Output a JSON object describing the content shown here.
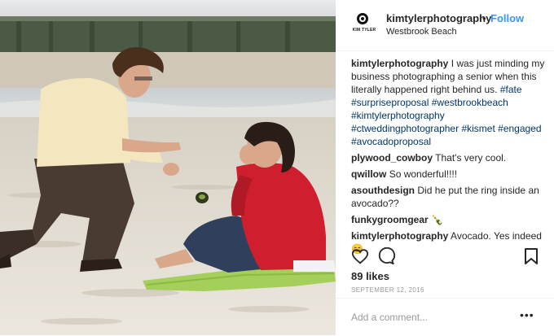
{
  "header": {
    "avatar_text": "KIM TYLER",
    "username": "kimtylerphotography",
    "separator": "•",
    "follow_label": "Follow",
    "location": "Westbrook Beach"
  },
  "caption": {
    "username": "kimtylerphotography",
    "text": "I was just minding my business photographing a senior when this literally happened right behind us.",
    "hashtags": [
      "#fate",
      "#surpriseproposal",
      "#westbrookbeach",
      "#kimtylerphotography",
      "#ctweddingphotographer",
      "#kismet",
      "#engaged",
      "#avocadoproposal"
    ]
  },
  "comments": [
    {
      "username": "plywood_cowboy",
      "text": "That's very cool."
    },
    {
      "username": "qwillow",
      "text": "So wonderful!!!!"
    },
    {
      "username": "asouthdesign",
      "text": "Did he put the ring inside an avocado??"
    },
    {
      "username": "funkygroomgear",
      "text": "🍾"
    },
    {
      "username": "kimtylerphotography",
      "text": "Avocado. Yes indeed 😊"
    }
  ],
  "actions": {
    "like_icon": "heart-icon",
    "comment_icon": "comment-icon",
    "save_icon": "bookmark-icon"
  },
  "likes": "89 likes",
  "date": "SEPTEMBER 12, 2016",
  "add_comment": {
    "placeholder": "Add a comment...",
    "more_label": "•••"
  },
  "colors": {
    "link_blue": "#3897f0",
    "hashtag": "#003569",
    "muted": "#999999"
  }
}
